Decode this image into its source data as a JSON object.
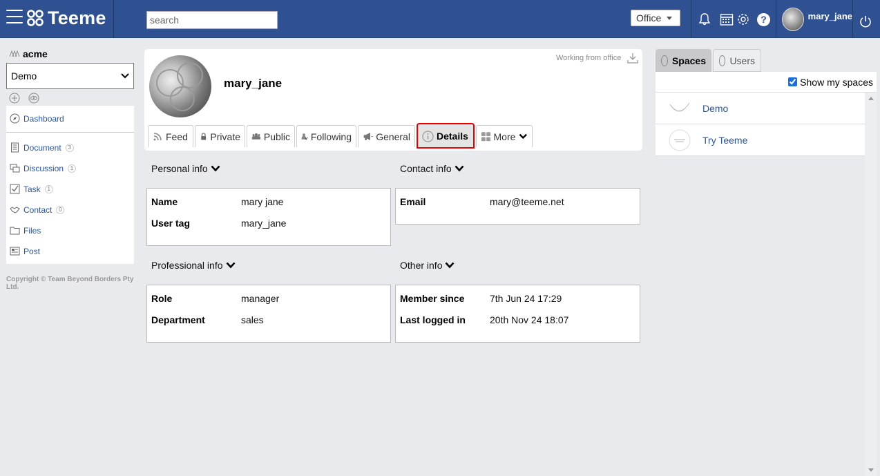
{
  "app": {
    "name": "Teeme"
  },
  "header": {
    "search_placeholder": "search",
    "office_select": "Office",
    "user_name": "mary_jane"
  },
  "sidebar": {
    "org_name": "acme",
    "space_select": "Demo",
    "dashboard": "Dashboard",
    "items": [
      {
        "label": "Document",
        "count": "3"
      },
      {
        "label": "Discussion",
        "count": "1"
      },
      {
        "label": "Task",
        "count": "1"
      },
      {
        "label": "Contact",
        "count": "0"
      },
      {
        "label": "Files",
        "count": ""
      },
      {
        "label": "Post",
        "count": ""
      }
    ],
    "copyright": "Copyright © Team Beyond Borders Pty Ltd."
  },
  "profile": {
    "name": "mary_jane",
    "work_status": "Working from office",
    "tabs": {
      "feed": "Feed",
      "private": "Private",
      "public": "Public",
      "following": "Following",
      "general": "General",
      "details": "Details",
      "more": "More"
    }
  },
  "details": {
    "personal": {
      "title": "Personal info",
      "name_label": "Name",
      "name_value": "mary jane",
      "tag_label": "User tag",
      "tag_value": "mary_jane"
    },
    "contact": {
      "title": "Contact info",
      "email_label": "Email",
      "email_value": "mary@teeme.net"
    },
    "professional": {
      "title": "Professional info",
      "role_label": "Role",
      "role_value": "manager",
      "dept_label": "Department",
      "dept_value": "sales"
    },
    "other": {
      "title": "Other info",
      "since_label": "Member since",
      "since_value": "7th Jun 24 17:29",
      "last_label": "Last logged in",
      "last_value": "20th Nov 24 18:07"
    }
  },
  "right_panel": {
    "tab_spaces": "Spaces",
    "tab_users": "Users",
    "show_my_spaces": "Show my spaces",
    "spaces": [
      {
        "label": "Demo"
      },
      {
        "label": "Try Teeme"
      }
    ]
  },
  "colors": {
    "header": "#2f5192",
    "link": "#2a56a0",
    "active_outline": "#e00000"
  }
}
